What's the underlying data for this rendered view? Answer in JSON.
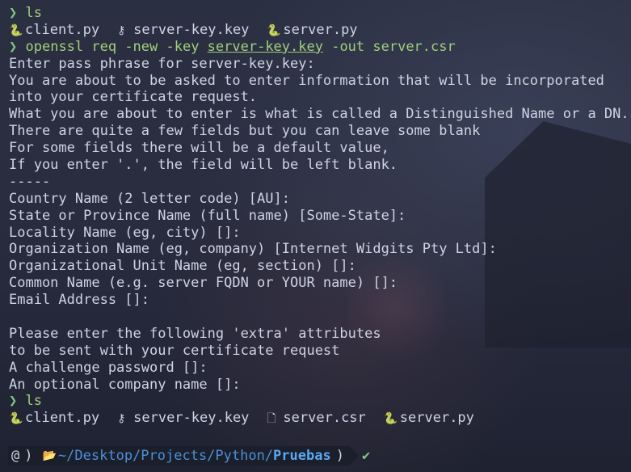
{
  "lines": [
    {
      "kind": "prompt",
      "prompt": "❯",
      "command": "ls"
    },
    {
      "kind": "files",
      "files": [
        {
          "icon": "python-icon",
          "glyph": "🐍",
          "name": "client.py"
        },
        {
          "icon": "key-icon",
          "glyph": "⚷",
          "name": "server-key.key"
        },
        {
          "icon": "python-icon",
          "glyph": "🐍",
          "name": "server.py"
        }
      ]
    },
    {
      "kind": "prompt",
      "prompt": "❯",
      "command": "openssl req -new -key server-key.key -out server.csr"
    },
    {
      "kind": "text",
      "text": "Enter pass phrase for server-key.key:"
    },
    {
      "kind": "text",
      "text": "You are about to be asked to enter information that will be incorporated"
    },
    {
      "kind": "text",
      "text": "into your certificate request."
    },
    {
      "kind": "text",
      "text": "What you are about to enter is what is called a Distinguished Name or a DN."
    },
    {
      "kind": "text",
      "text": "There are quite a few fields but you can leave some blank"
    },
    {
      "kind": "text",
      "text": "For some fields there will be a default value,"
    },
    {
      "kind": "text",
      "text": "If you enter '.', the field will be left blank."
    },
    {
      "kind": "text",
      "text": "-----"
    },
    {
      "kind": "text",
      "text": "Country Name (2 letter code) [AU]:"
    },
    {
      "kind": "text",
      "text": "State or Province Name (full name) [Some-State]:"
    },
    {
      "kind": "text",
      "text": "Locality Name (eg, city) []:"
    },
    {
      "kind": "text",
      "text": "Organization Name (eg, company) [Internet Widgits Pty Ltd]:"
    },
    {
      "kind": "text",
      "text": "Organizational Unit Name (eg, section) []:"
    },
    {
      "kind": "text",
      "text": "Common Name (e.g. server FQDN or YOUR name) []:"
    },
    {
      "kind": "text",
      "text": "Email Address []:"
    },
    {
      "kind": "text",
      "text": ""
    },
    {
      "kind": "text",
      "text": "Please enter the following 'extra' attributes"
    },
    {
      "kind": "text",
      "text": "to be sent with your certificate request"
    },
    {
      "kind": "text",
      "text": "A challenge password []:"
    },
    {
      "kind": "text",
      "text": "An optional company name []:"
    },
    {
      "kind": "prompt",
      "prompt": "❯",
      "command": "ls"
    },
    {
      "kind": "files",
      "files": [
        {
          "icon": "python-icon",
          "glyph": "🐍",
          "name": "client.py"
        },
        {
          "icon": "key-icon",
          "glyph": "⚷",
          "name": "server-key.key"
        },
        {
          "icon": "file-icon",
          "glyph": "🗋",
          "name": "server.csr"
        },
        {
          "icon": "python-icon",
          "glyph": "🐍",
          "name": "server.py"
        }
      ]
    }
  ],
  "statusbar": {
    "os_glyph": "@",
    "separator": ")",
    "folder_glyph": "📂",
    "path_prefix": "~/Desktop/Projects/Python/",
    "path_current": "Pruebas",
    "end_separator": ")",
    "check": "✔"
  },
  "colors": {
    "prompt": "#7fc97f",
    "command": "#9fd07a",
    "text": "#cfd3e4",
    "path": "#4d8fd6"
  }
}
